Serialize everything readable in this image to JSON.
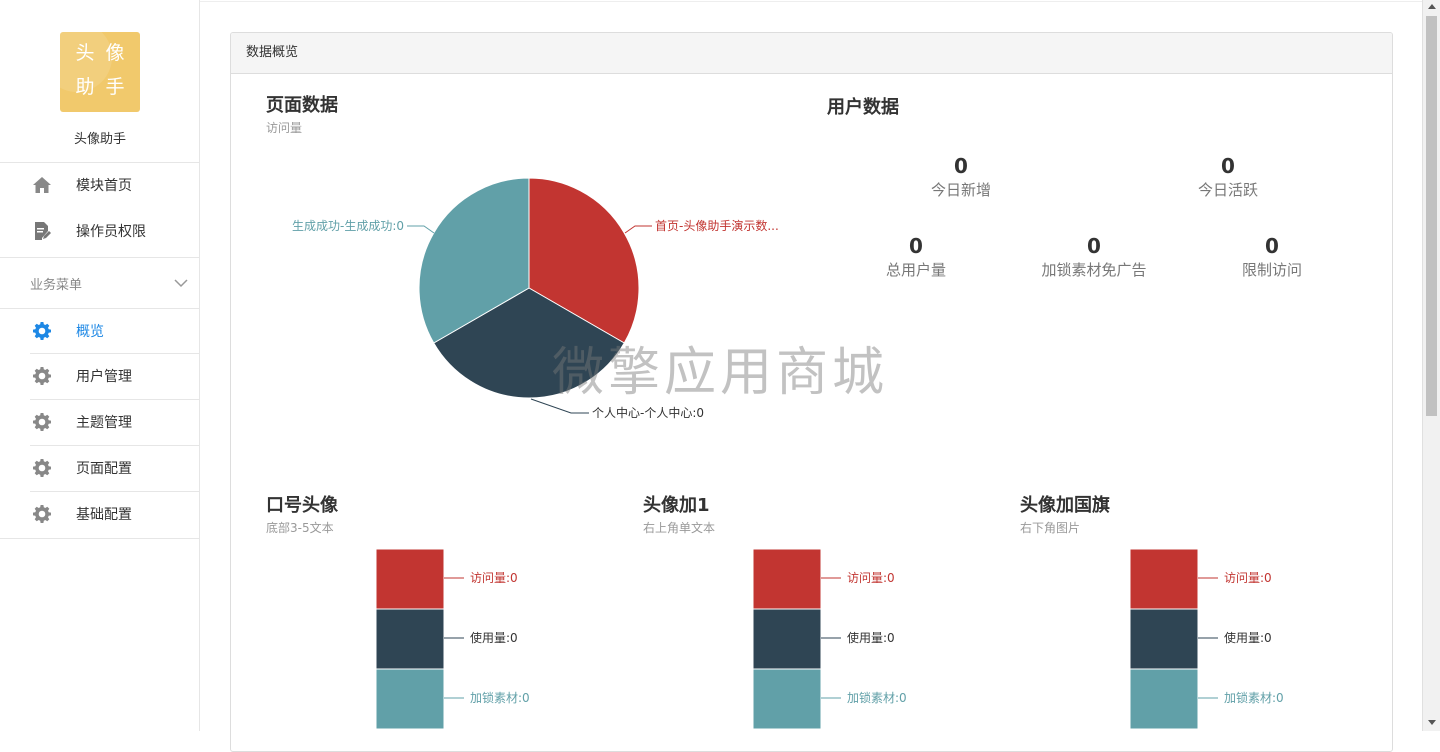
{
  "sidebar": {
    "logo_chars": [
      "头",
      "像",
      "助",
      "手"
    ],
    "app_name": "头像助手",
    "items": [
      {
        "label": "模块首页",
        "icon": "home-icon"
      },
      {
        "label": "操作员权限",
        "icon": "document-edit-icon"
      }
    ],
    "group_title": "业务菜单",
    "group_items": [
      {
        "label": "概览",
        "icon": "gear-icon",
        "active": true
      },
      {
        "label": "用户管理",
        "icon": "gear-icon"
      },
      {
        "label": "主题管理",
        "icon": "gear-icon"
      },
      {
        "label": "页面配置",
        "icon": "gear-icon"
      },
      {
        "label": "基础配置",
        "icon": "gear-icon"
      }
    ]
  },
  "panel": {
    "title": "数据概览"
  },
  "page_data_section": {
    "title": "页面数据",
    "subtitle": "访问量"
  },
  "user_data_section": {
    "title": "用户数据",
    "stats": [
      {
        "value": "0",
        "label": "今日新增"
      },
      {
        "value": "0",
        "label": "今日活跃"
      },
      {
        "value": "0",
        "label": "总用户量"
      },
      {
        "value": "0",
        "label": "加锁素材免广告"
      },
      {
        "value": "0",
        "label": "限制访问"
      }
    ]
  },
  "watermark": "微擎应用商城",
  "colors": {
    "red": "#c23531",
    "dark": "#2f4554",
    "teal": "#61a0a8",
    "active_blue": "#1e88e5"
  },
  "chart_data": [
    {
      "type": "pie",
      "title": "页面数据",
      "subtitle": "访问量",
      "slices": [
        {
          "name": "首页-头像助手演示数...",
          "value": 0,
          "color": "#c23531"
        },
        {
          "name": "个人中心-个人中心",
          "value": 0,
          "color": "#2f4554"
        },
        {
          "name": "生成成功-生成成功",
          "value": 0,
          "color": "#61a0a8"
        }
      ],
      "labels": [
        "首页-头像助手演示数...",
        "个人中心-个人中心:0",
        "生成成功-生成成功:0"
      ]
    },
    {
      "type": "pie",
      "title": "口号头像",
      "subtitle": "底部3-5文本",
      "slices": [
        {
          "name": "访问量",
          "value": 0,
          "color": "#c23531"
        },
        {
          "name": "使用量",
          "value": 0,
          "color": "#2f4554"
        },
        {
          "name": "加锁素材",
          "value": 0,
          "color": "#61a0a8"
        }
      ],
      "labels": [
        "访问量:0",
        "使用量:0",
        "加锁素材:0"
      ]
    },
    {
      "type": "pie",
      "title": "头像加1",
      "subtitle": "右上角单文本",
      "slices": [
        {
          "name": "访问量",
          "value": 0,
          "color": "#c23531"
        },
        {
          "name": "使用量",
          "value": 0,
          "color": "#2f4554"
        },
        {
          "name": "加锁素材",
          "value": 0,
          "color": "#61a0a8"
        }
      ],
      "labels": [
        "访问量:0",
        "使用量:0",
        "加锁素材:0"
      ]
    },
    {
      "type": "pie",
      "title": "头像加国旗",
      "subtitle": "右下角图片",
      "slices": [
        {
          "name": "访问量",
          "value": 0,
          "color": "#c23531"
        },
        {
          "name": "使用量",
          "value": 0,
          "color": "#2f4554"
        },
        {
          "name": "加锁素材",
          "value": 0,
          "color": "#61a0a8"
        }
      ],
      "labels": [
        "访问量:0",
        "使用量:0",
        "加锁素材:0"
      ]
    }
  ]
}
